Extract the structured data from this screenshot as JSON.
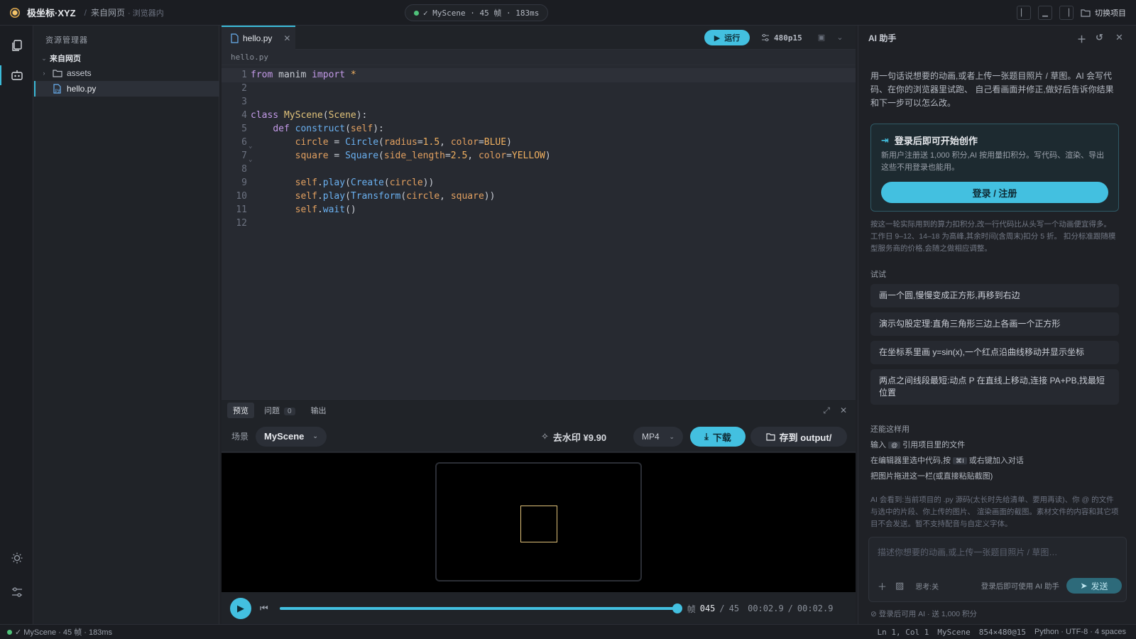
{
  "titlebar": {
    "brand": "极坐标·XYZ",
    "breadcrumb_source": "来自网页",
    "breadcrumb_context": "· 浏览器内",
    "status_text": "✓ MyScene · 45 帧 · 183ms",
    "switch_project": "切换项目"
  },
  "explorer": {
    "title": "资源管理器",
    "root": "来自网页",
    "folder": "assets",
    "file": "hello.py"
  },
  "editor": {
    "tab_name": "hello.py",
    "path": "hello.py",
    "run_label": "运行",
    "quality": "480p15",
    "line_numbers": [
      "1",
      "2",
      "3",
      "4",
      "5",
      "6",
      "7",
      "8",
      "9",
      "10",
      "11",
      "12"
    ]
  },
  "panel": {
    "tabs": {
      "preview": "预览",
      "problems": "问题",
      "problems_count": "0",
      "output": "输出"
    },
    "scene_label": "场景",
    "scene_value": "MyScene",
    "watermark": "去水印 ¥9.90",
    "format": "MP4",
    "download": "下载",
    "save_output": "存到 output/",
    "progress": 1.0,
    "frame_label": "帧",
    "frame_current": "045",
    "frame_sep": "/",
    "frame_total": "45",
    "time_current": "00:02.9",
    "time_sep": "/",
    "time_total": "00:02.9"
  },
  "ai": {
    "title": "AI 助手",
    "intro": "用一句话说想要的动画,或者上传一张题目照片 / 草图。AI 会写代码、在你的浏览器里试跑、 自己看画面并修正,做好后告诉你结果和下一步可以怎么改。",
    "login_title": "登录后即可开始创作",
    "login_desc": "新用户注册送 1,000 积分,AI 按用量扣积分。写代码、渲染、导出这些不用登录也能用。",
    "login_button": "登录 / 注册",
    "billing": "按这一轮实际用到的算力扣积分,改一行代码比从头写一个动画便宜得多。 工作日 9–12、14–18 为高峰,其余时间(含周末)扣分 5 折。 扣分标准跟随模型服务商的价格,会随之做相应调整。",
    "try_label": "试试",
    "suggestions": [
      "画一个圆,慢慢变成正方形,再移到右边",
      "演示勾股定理:直角三角形三边上各画一个正方形",
      "在坐标系里画 y=sin(x),一个红点沿曲线移动并显示坐标",
      "两点之间线段最短:动点 P 在直线上移动,连接 PA+PB,找最短位置"
    ],
    "more_label": "还能这样用",
    "tip1_pre": "输入",
    "tip1_key": "@",
    "tip1_post": "引用项目里的文件",
    "tip2_pre": "在编辑器里选中代码,按",
    "tip2_key": "⌘I",
    "tip2_post": "或右键加入对话",
    "tip3": "把图片拖进这一栏(或直接粘贴截图)",
    "privacy": "AI 会看到:当前项目的 .py 源码(太长时先给清单、要用再读)、你 @ 的文件与选中的片段、你上传的图片、 渲染画面的截图。素材文件的内容和其它项目不会发送。暂不支持配音与自定义字体。",
    "composer_placeholder": "描述你想要的动画,或上传一张题目照片 / 草图…",
    "think": "思考:关",
    "composer_hint": "登录后即可使用 AI 助手",
    "send": "发送",
    "footer": "登录后可用 AI · 送 1,000 积分"
  },
  "statusbar": {
    "left": "✓ MyScene · 45 帧 · 183ms",
    "position": "Ln 1, Col 1",
    "scene": "MyScene",
    "resolution": "854×480@15",
    "lang": "Python · UTF-8 · 4 spaces"
  },
  "colors": {
    "accent": "#43c0e0",
    "ok": "#4fc27a",
    "yellow": "#e0c27a"
  }
}
